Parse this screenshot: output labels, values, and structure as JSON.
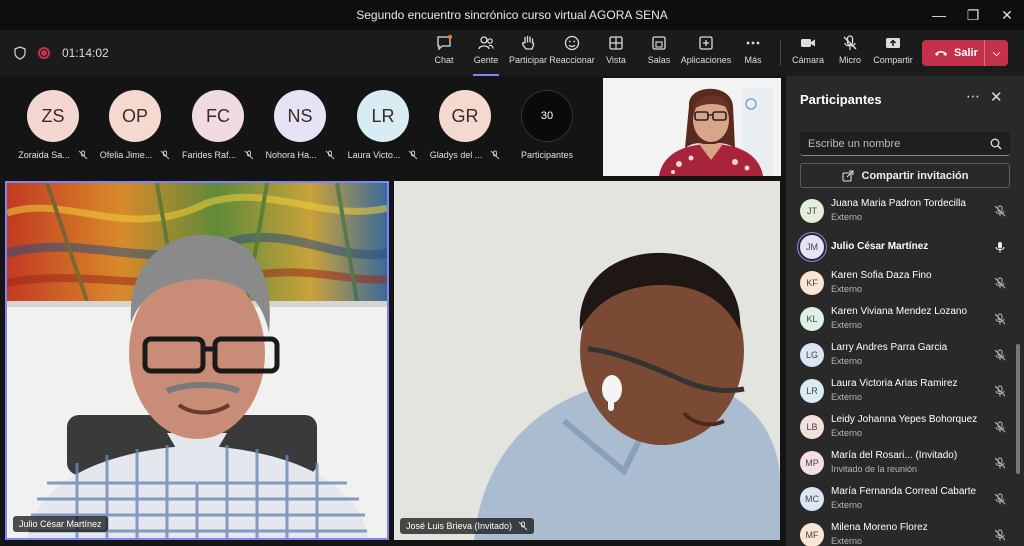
{
  "window": {
    "title": "Segundo encuentro sincrónico curso virtual AGORA SENA"
  },
  "toolbar": {
    "timer": "01:14:02",
    "buttons": [
      {
        "label": "Chat",
        "icon": "chat-icon"
      },
      {
        "label": "Gente",
        "icon": "people-icon"
      },
      {
        "label": "Participar",
        "icon": "raise-hand-icon"
      },
      {
        "label": "Reaccionar",
        "icon": "smile-icon"
      },
      {
        "label": "Vista",
        "icon": "grid-view-icon"
      },
      {
        "label": "Salas",
        "icon": "rooms-icon"
      },
      {
        "label": "Aplicaciones",
        "icon": "add-apps-icon"
      },
      {
        "label": "Más",
        "icon": "more-icon"
      },
      {
        "label": "Cámara",
        "icon": "camera-icon"
      },
      {
        "label": "Micro",
        "icon": "mic-off-icon"
      },
      {
        "label": "Compartir",
        "icon": "share-icon"
      }
    ],
    "leave_label": "Salir"
  },
  "gallery": {
    "avatars": [
      {
        "initials": "ZS",
        "name": "Zoraida Sa...",
        "color": "#f2d6cf"
      },
      {
        "initials": "OP",
        "name": "Ofelia Jime...",
        "color": "#f4d9d0"
      },
      {
        "initials": "FC",
        "name": "Farides Raf...",
        "color": "#f1dbe0"
      },
      {
        "initials": "NS",
        "name": "Nohora Ha...",
        "color": "#e6e3f6"
      },
      {
        "initials": "LR",
        "name": "Laura Victo...",
        "color": "#d8ecf4"
      },
      {
        "initials": "GR",
        "name": "Gladys del ...",
        "color": "#f4d9d0"
      }
    ],
    "more": {
      "count": "30",
      "label": "Participantes"
    }
  },
  "videos": [
    {
      "name": "Julio César Martínez"
    },
    {
      "name": "José Luis Brieva (Invitado)"
    }
  ],
  "panel": {
    "title": "Participantes",
    "search_placeholder": "Escribe un nombre",
    "share_label": "Compartir invitación",
    "participants": [
      {
        "initials": "JT",
        "name": "Juana Maria Padron Tordecilla",
        "sub": "Externo",
        "color": "#e4efd9",
        "mic": "off"
      },
      {
        "initials": "JM",
        "name": "Julio César Martínez",
        "sub": "",
        "color": "#e6e3f6",
        "mic": "on",
        "bold": true
      },
      {
        "initials": "KF",
        "name": "Karen Sofia Daza Fino",
        "sub": "Externo",
        "color": "#fbe6d5",
        "mic": "off"
      },
      {
        "initials": "KL",
        "name": "Karen Viviana Mendez Lozano",
        "sub": "Externo",
        "color": "#dff0e4",
        "mic": "off"
      },
      {
        "initials": "LG",
        "name": "Larry Andres Parra Garcia",
        "sub": "Externo",
        "color": "#dde4f5",
        "mic": "off"
      },
      {
        "initials": "LR",
        "name": "Laura Victoria Arias Ramirez",
        "sub": "Externo",
        "color": "#d8ecf4",
        "mic": "off"
      },
      {
        "initials": "LB",
        "name": "Leidy Johanna Yepes Bohorquez",
        "sub": "Externo",
        "color": "#f2e0dc",
        "mic": "off"
      },
      {
        "initials": "MP",
        "name": "María del Rosari...  (Invitado)",
        "sub": "Invitado de la reunión",
        "color": "#f6dde8",
        "mic": "off"
      },
      {
        "initials": "MC",
        "name": "María Fernanda Correal Cabarte",
        "sub": "Externo",
        "color": "#dde4f5",
        "mic": "off"
      },
      {
        "initials": "MF",
        "name": "Milena Moreno Florez",
        "sub": "Externo",
        "color": "#fbe6d5",
        "mic": "off"
      }
    ]
  },
  "colors": {
    "accent": "#7f85f5",
    "leave": "#c4314b"
  }
}
